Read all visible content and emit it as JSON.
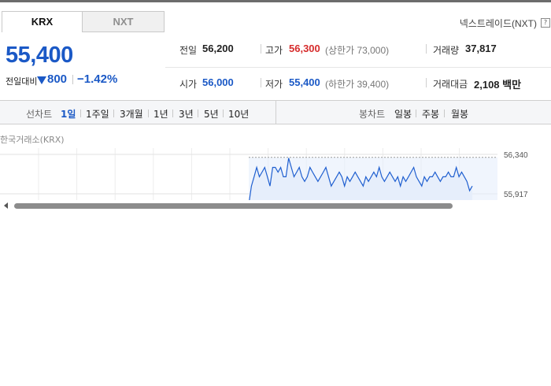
{
  "tabs": [
    {
      "label": "KRX",
      "active": true
    },
    {
      "label": "NXT",
      "active": false
    }
  ],
  "nxt_link": {
    "label": "넥스트레이드(NXT)",
    "icon": "help-icon"
  },
  "quote": {
    "price": "55,400",
    "change_label": "전일대비",
    "change_direction": "down",
    "change_amount": "800",
    "change_percent": "−1.42%",
    "color": "#1b59c6"
  },
  "stats": {
    "prev_close": {
      "label": "전일",
      "value": "56,200"
    },
    "high": {
      "label": "고가",
      "value": "56,300",
      "sub": "(상한가 73,000)"
    },
    "volume": {
      "label": "거래량",
      "value": "37,817"
    },
    "open": {
      "label": "시가",
      "value": "56,000"
    },
    "low": {
      "label": "저가",
      "value": "55,400",
      "sub": "(하한가 39,400)"
    },
    "amount": {
      "label": "거래대금",
      "value": "2,108 백만"
    }
  },
  "toolbar": {
    "line_chart_label": "선차트",
    "periods": [
      "1일",
      "1주일",
      "3개월",
      "1년",
      "3년",
      "5년",
      "10년"
    ],
    "active_period": "1일",
    "candle_chart_label": "봉차트",
    "candle_periods": [
      "일봉",
      "주봉",
      "월봉"
    ]
  },
  "exchange_label": "한국거래소(KRX)",
  "chart_data": {
    "type": "line",
    "title": "",
    "xlabel": "",
    "ylabel": "",
    "y_ticks": [
      "56,340",
      "55,917"
    ],
    "ylim": [
      55700,
      56400
    ],
    "grid": true,
    "series": [
      {
        "values": [
          55800,
          56000,
          56100,
          56200,
          56100,
          56150,
          56200,
          56100,
          56000,
          56200,
          56200,
          56150,
          56200,
          56100,
          56100,
          56300,
          56200,
          56100,
          56150,
          56200,
          56100,
          56050,
          56100,
          56200,
          56150,
          56100,
          56050,
          56100,
          56150,
          56200,
          56100,
          56000,
          56050,
          56100,
          56150,
          56100,
          56000,
          56100,
          56050,
          56100,
          56150,
          56100,
          56050,
          56000,
          56100,
          56050,
          56100,
          56150,
          56100,
          56200,
          56100,
          56050,
          56100,
          56150,
          56100,
          56050,
          56100,
          56000,
          56100,
          56050,
          56100,
          56150,
          56200,
          56100,
          56050,
          56000,
          56100,
          56050,
          56100,
          56100,
          56150,
          56100,
          56050,
          56100,
          56100,
          56150,
          56100,
          56100,
          56200,
          56100,
          56150,
          56100,
          56050,
          55950,
          56000
        ]
      }
    ],
    "line_color": "#1f5fd0",
    "fill_color": "#e6eefb"
  }
}
